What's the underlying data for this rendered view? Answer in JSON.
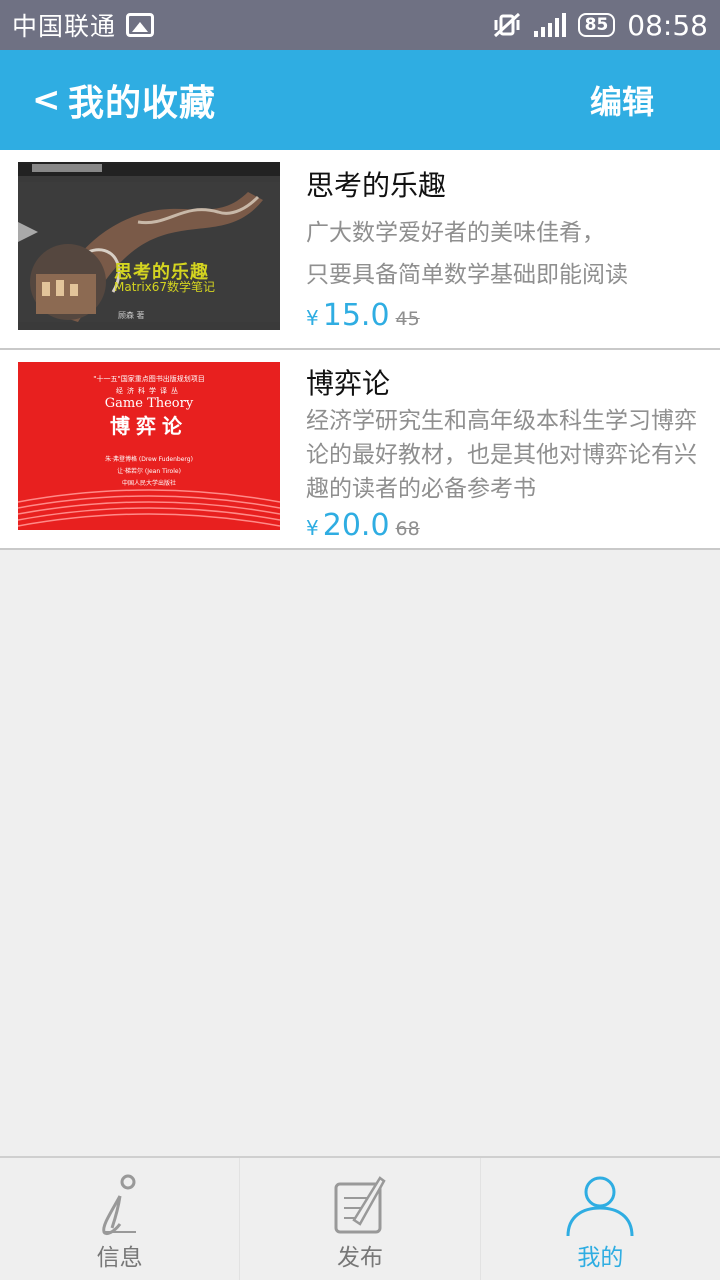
{
  "status_bar": {
    "carrier": "中国联通",
    "battery": "85",
    "time": "08:58"
  },
  "header": {
    "back_label": "<",
    "title": "我的收藏",
    "edit_label": "编辑"
  },
  "favorites": [
    {
      "name": "思考的乐趣",
      "desc_lines": [
        "广大数学爱好者的美味佳肴，",
        "只要具备简单数学基础即能阅读"
      ],
      "currency": "¥",
      "price": "15.0",
      "original_price": "45",
      "cover": {
        "title": "思考的乐趣",
        "subtitle": "Matrix67数学笔记",
        "author": "顾森 著"
      }
    },
    {
      "name": "博弈论",
      "desc": "经济学研究生和高年级本科生学习博弈论的最好教材，也是其他对博弈论有兴趣的读者的必备参考书",
      "currency": "¥",
      "price": "20.0",
      "original_price": "68",
      "cover": {
        "top_text": "\"十一五\"国家重点图书出版规划项目",
        "series": "经济科学译丛",
        "english_title": "Game Theory",
        "title": "博弈论",
        "author1": "朱·弗登博格 (Drew Fudenberg)",
        "author2": "让·梯若尔 (Jean Tirole)",
        "publisher": "中国人民大学出版社"
      }
    }
  ],
  "tabs": [
    {
      "label": "信息",
      "icon": "info-icon"
    },
    {
      "label": "发布",
      "icon": "publish-icon"
    },
    {
      "label": "我的",
      "icon": "user-icon"
    }
  ],
  "colors": {
    "status_bar": "#6f7183",
    "accent": "#2fade2",
    "background": "#efefef",
    "muted_text": "#8f8f8f",
    "cover_red": "#e8201f"
  }
}
